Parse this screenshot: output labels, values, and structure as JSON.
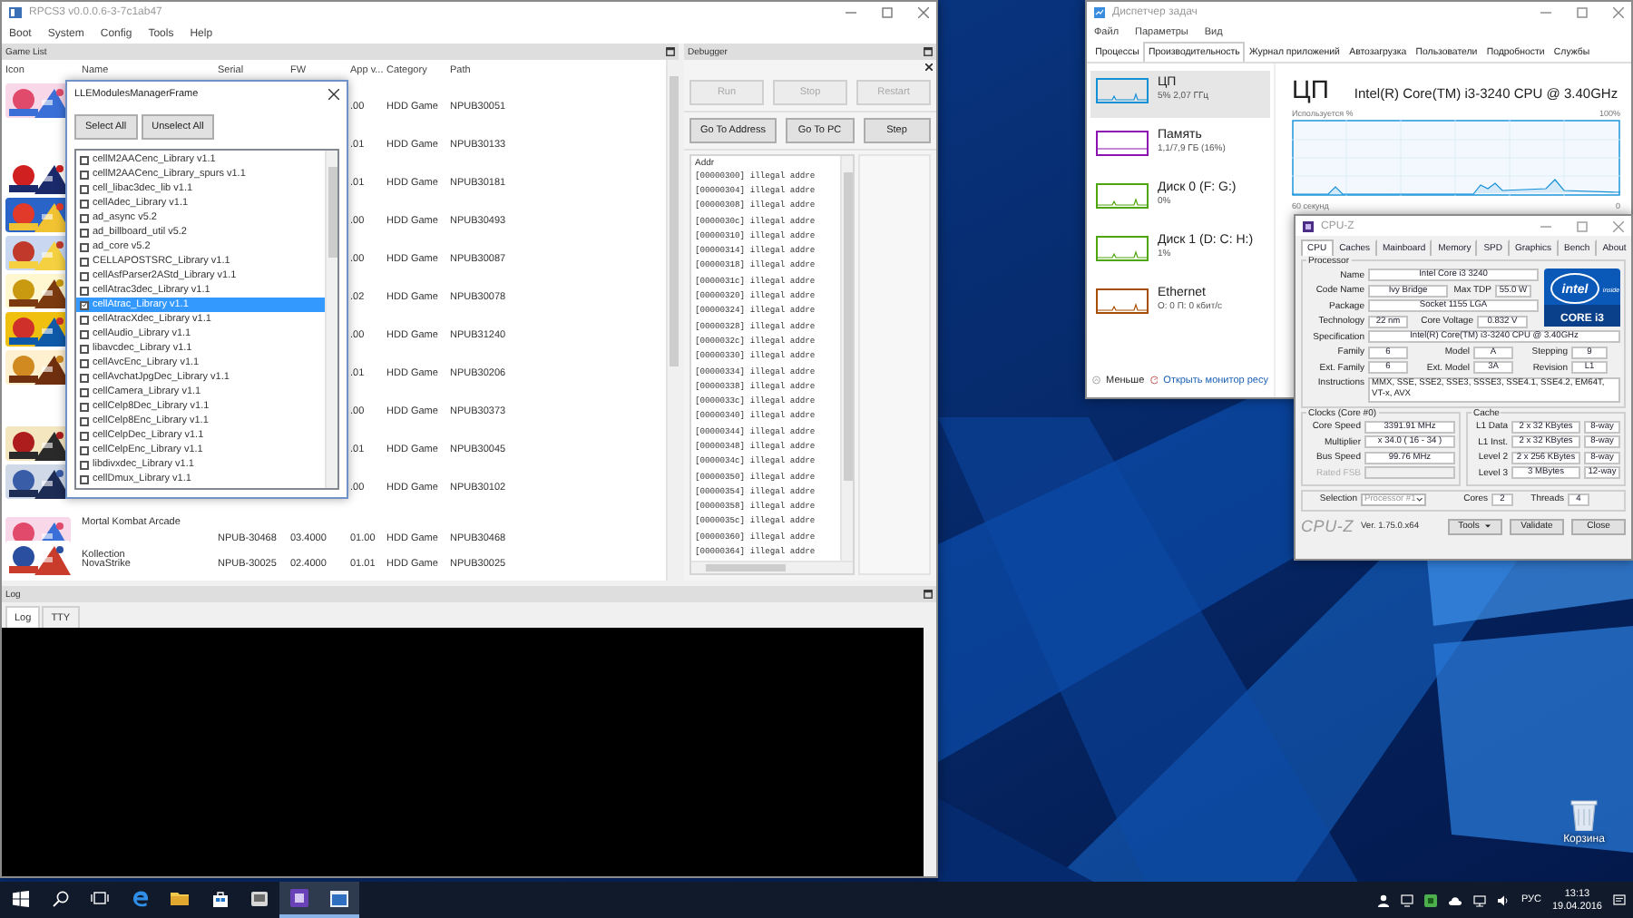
{
  "desktop": {
    "recycle_bin_label": "Корзина"
  },
  "rpcs3": {
    "title": "RPCS3 v0.0.0.6-3-7c1ab47",
    "menu": [
      "Boot",
      "System",
      "Config",
      "Tools",
      "Help"
    ],
    "game_list": {
      "title": "Game List",
      "columns": [
        "Icon",
        "Name",
        "Serial",
        "FW",
        "App v...",
        "Category",
        "Path"
      ],
      "rows": [
        {
          "app_version": ".00",
          "category": "HDD Game",
          "path": "NPUB30051"
        },
        {
          "app_version": ".01",
          "category": "HDD Game",
          "path": "NPUB30133"
        },
        {
          "app_version": ".01",
          "category": "HDD Game",
          "path": "NPUB30181"
        },
        {
          "app_version": ".00",
          "category": "HDD Game",
          "path": "NPUB30493"
        },
        {
          "app_version": ".00",
          "category": "HDD Game",
          "path": "NPUB30087"
        },
        {
          "app_version": ".02",
          "category": "HDD Game",
          "path": "NPUB30078"
        },
        {
          "app_version": ".00",
          "category": "HDD Game",
          "path": "NPUB31240"
        },
        {
          "app_version": ".01",
          "category": "HDD Game",
          "path": "NPUB30206"
        },
        {
          "app_version": ".00",
          "category": "HDD Game",
          "path": "NPUB30373"
        },
        {
          "app_version": ".01",
          "category": "HDD Game",
          "path": "NPUB30045"
        },
        {
          "app_version": ".00",
          "category": "HDD Game",
          "path": "NPUB30102"
        },
        {
          "name": "Mortal Kombat Arcade Kollection",
          "serial": "NPUB-30468",
          "fw": "03.4000",
          "app_version": "01.00",
          "category": "HDD Game",
          "path": "NPUB30468"
        },
        {
          "name": "NovaStrike",
          "serial": "NPUB-30025",
          "fw": "02.4000",
          "app_version": "01.01",
          "category": "HDD Game",
          "path": "NPUB30025"
        }
      ]
    },
    "lle_dialog": {
      "title": "LLEModulesManagerFrame",
      "buttons": [
        "Select All",
        "Unselect All"
      ],
      "modules": [
        {
          "label": "cellM2AACenc_Library v1.1",
          "checked": false,
          "selected": false
        },
        {
          "label": "cellM2AACenc_Library_spurs v1.1",
          "checked": false,
          "selected": false
        },
        {
          "label": "cell_libac3dec_lib v1.1",
          "checked": false,
          "selected": false
        },
        {
          "label": "cellAdec_Library v1.1",
          "checked": false,
          "selected": false
        },
        {
          "label": "ad_async v5.2",
          "checked": false,
          "selected": false
        },
        {
          "label": "ad_billboard_util v5.2",
          "checked": false,
          "selected": false
        },
        {
          "label": "ad_core v5.2",
          "checked": false,
          "selected": false
        },
        {
          "label": "CELLAPOSTSRC_Library v1.1",
          "checked": false,
          "selected": false
        },
        {
          "label": "cellAsfParser2AStd_Library v1.1",
          "checked": false,
          "selected": false
        },
        {
          "label": "cellAtrac3dec_Library v1.1",
          "checked": false,
          "selected": false
        },
        {
          "label": "cellAtrac_Library v1.1",
          "checked": true,
          "selected": true
        },
        {
          "label": "cellAtracXdec_Library v1.1",
          "checked": false,
          "selected": false
        },
        {
          "label": "cellAudio_Library v1.1",
          "checked": false,
          "selected": false
        },
        {
          "label": "libavcdec_Library v1.1",
          "checked": false,
          "selected": false
        },
        {
          "label": "cellAvcEnc_Library v1.1",
          "checked": false,
          "selected": false
        },
        {
          "label": "cellAvchatJpgDec_Library v1.1",
          "checked": false,
          "selected": false
        },
        {
          "label": "cellCamera_Library v1.1",
          "checked": false,
          "selected": false
        },
        {
          "label": "cellCelp8Dec_Library v1.1",
          "checked": false,
          "selected": false
        },
        {
          "label": "cellCelp8Enc_Library v1.1",
          "checked": false,
          "selected": false
        },
        {
          "label": "cellCelpDec_Library v1.1",
          "checked": false,
          "selected": false
        },
        {
          "label": "cellCelpEnc_Library v1.1",
          "checked": false,
          "selected": false
        },
        {
          "label": "libdivxdec_Library v1.1",
          "checked": false,
          "selected": false
        },
        {
          "label": "cellDmux_Library v1.1",
          "checked": false,
          "selected": false
        }
      ]
    },
    "debugger": {
      "title": "Debugger",
      "control_buttons": [
        {
          "label": "Run",
          "disabled": true
        },
        {
          "label": "Stop",
          "disabled": true
        },
        {
          "label": "Restart",
          "disabled": true
        }
      ],
      "nav_buttons": [
        "Go To Address",
        "Go To PC",
        "Step"
      ],
      "column": "Addr",
      "lines": [
        {
          "address": "[00000300]",
          "text": "illegal addre"
        },
        {
          "address": "[00000304]",
          "text": "illegal addre"
        },
        {
          "address": "[00000308]",
          "text": "illegal addre"
        },
        {
          "address": "[0000030c]",
          "text": "illegal addre"
        },
        {
          "address": "[00000310]",
          "text": "illegal addre"
        },
        {
          "address": "[00000314]",
          "text": "illegal addre"
        },
        {
          "address": "[00000318]",
          "text": "illegal addre"
        },
        {
          "address": "[0000031c]",
          "text": "illegal addre"
        },
        {
          "address": "[00000320]",
          "text": "illegal addre"
        },
        {
          "address": "[00000324]",
          "text": "illegal addre"
        },
        {
          "address": "[00000328]",
          "text": "illegal addre"
        },
        {
          "address": "[0000032c]",
          "text": "illegal addre"
        },
        {
          "address": "[00000330]",
          "text": "illegal addre"
        },
        {
          "address": "[00000334]",
          "text": "illegal addre"
        },
        {
          "address": "[00000338]",
          "text": "illegal addre"
        },
        {
          "address": "[0000033c]",
          "text": "illegal addre"
        },
        {
          "address": "[00000340]",
          "text": "illegal addre"
        },
        {
          "address": "[00000344]",
          "text": "illegal addre"
        },
        {
          "address": "[00000348]",
          "text": "illegal addre"
        },
        {
          "address": "[0000034c]",
          "text": "illegal addre"
        },
        {
          "address": "[00000350]",
          "text": "illegal addre"
        },
        {
          "address": "[00000354]",
          "text": "illegal addre"
        },
        {
          "address": "[00000358]",
          "text": "illegal addre"
        },
        {
          "address": "[0000035c]",
          "text": "illegal addre"
        },
        {
          "address": "[00000360]",
          "text": "illegal addre"
        },
        {
          "address": "[00000364]",
          "text": "illegal addre"
        }
      ]
    },
    "log": {
      "title": "Log",
      "tabs": [
        {
          "label": "Log",
          "selected": true
        },
        {
          "label": "TTY",
          "selected": false
        }
      ]
    }
  },
  "task_manager": {
    "title": "Диспетчер задач",
    "menu": [
      "Файл",
      "Параметры",
      "Вид"
    ],
    "tabs": [
      {
        "label": "Процессы",
        "selected": false
      },
      {
        "label": "Производительность",
        "selected": true
      },
      {
        "label": "Журнал приложений",
        "selected": false
      },
      {
        "label": "Автозагрузка",
        "selected": false
      },
      {
        "label": "Пользователи",
        "selected": false
      },
      {
        "label": "Подробности",
        "selected": false
      },
      {
        "label": "Службы",
        "selected": false
      }
    ],
    "resources": [
      {
        "name": "ЦП",
        "detail": "5% 2,07 ГГц",
        "color": "#1190d8",
        "selected": true
      },
      {
        "name": "Память",
        "detail": "1,1/7,9 ГБ (16%)",
        "color": "#8b12ae",
        "selected": false
      },
      {
        "name": "Диск 0 (F: G:)",
        "detail": "0%",
        "color": "#4da60c",
        "selected": false
      },
      {
        "name": "Диск 1 (D: C: H:)",
        "detail": "1%",
        "color": "#4da60c",
        "selected": false
      },
      {
        "name": "Ethernet",
        "detail": "О: 0 П: 0 кбит/с",
        "color": "#a74f01",
        "selected": false
      }
    ],
    "heading": "ЦП",
    "model": "Intel(R) Core(TM) i3-3240 CPU @ 3.40GHz",
    "graph": {
      "label": "Используется %",
      "max": "100%",
      "span": "60 секунд",
      "min": "0"
    },
    "footer": {
      "less": "Меньше",
      "monitor_link": "Открыть монитор ресу"
    }
  },
  "cpuz": {
    "title": "CPU-Z",
    "tabs": [
      {
        "label": "CPU",
        "selected": true
      },
      {
        "label": "Caches",
        "selected": false
      },
      {
        "label": "Mainboard",
        "selected": false
      },
      {
        "label": "Memory",
        "selected": false
      },
      {
        "label": "SPD",
        "selected": false
      },
      {
        "label": "Graphics",
        "selected": false
      },
      {
        "label": "Bench",
        "selected": false
      },
      {
        "label": "About",
        "selected": false
      }
    ],
    "processor": {
      "legend": "Processor",
      "name": {
        "label": "Name",
        "value": "Intel Core i3 3240"
      },
      "code_name": {
        "label": "Code Name",
        "value": "Ivy Bridge"
      },
      "max_tdp": {
        "label": "Max TDP",
        "value": "55.0 W"
      },
      "package": {
        "label": "Package",
        "value": "Socket 1155 LGA"
      },
      "technology": {
        "label": "Technology",
        "value": "22 nm"
      },
      "core_voltage": {
        "label": "Core Voltage",
        "value": "0.832 V"
      },
      "specification": {
        "label": "Specification",
        "value": "Intel(R) Core(TM) i3-3240 CPU @ 3.40GHz"
      },
      "family": {
        "label": "Family",
        "value": "6"
      },
      "model": {
        "label": "Model",
        "value": "A"
      },
      "stepping": {
        "label": "Stepping",
        "value": "9"
      },
      "ext_family": {
        "label": "Ext. Family",
        "value": "6"
      },
      "ext_model": {
        "label": "Ext. Model",
        "value": "3A"
      },
      "revision": {
        "label": "Revision",
        "value": "L1"
      },
      "instructions": {
        "label": "Instructions",
        "value": "MMX, SSE, SSE2, SSE3, SSSE3, SSE4.1, SSE4.2, EM64T, VT-x, AVX"
      },
      "logo": {
        "brand": "intel",
        "tagline": "inside",
        "line": "CORE i3"
      }
    },
    "clocks": {
      "legend": "Clocks (Core #0)",
      "rows": [
        {
          "label": "Core Speed",
          "value": "3391.91 MHz",
          "disabled": false
        },
        {
          "label": "Multiplier",
          "value": "x 34.0 ( 16 - 34 )",
          "disabled": false
        },
        {
          "label": "Bus Speed",
          "value": "99.76 MHz",
          "disabled": false
        },
        {
          "label": "Rated FSB",
          "disabled": true
        }
      ]
    },
    "cache": {
      "legend": "Cache",
      "rows": [
        {
          "label": "L1 Data",
          "size": "2 x 32 KBytes",
          "ways": "8-way"
        },
        {
          "label": "L1 Inst.",
          "size": "2 x 32 KBytes",
          "ways": "8-way"
        },
        {
          "label": "Level 2",
          "size": "2 x 256 KBytes",
          "ways": "8-way"
        },
        {
          "label": "Level 3",
          "size": "3 MBytes",
          "ways": "12-way"
        }
      ]
    },
    "selection": {
      "label": "Selection",
      "value": "Processor #1",
      "cores_label": "Cores",
      "cores": "2",
      "threads_label": "Threads",
      "threads": "4"
    },
    "footer": {
      "brand": "CPU-Z",
      "version": "Ver. 1.75.0.x64",
      "buttons": [
        "Tools",
        "Validate",
        "Close"
      ]
    }
  },
  "taskbar": {
    "apps": [
      {
        "kind": "start",
        "active": false
      },
      {
        "kind": "search",
        "active": false
      },
      {
        "kind": "task_view",
        "active": false
      },
      {
        "kind": "browser",
        "active": false
      },
      {
        "kind": "folder",
        "active": false
      },
      {
        "kind": "store",
        "active": false
      },
      {
        "kind": "app",
        "active": false
      },
      {
        "kind": "chip",
        "active": true
      },
      {
        "kind": "window",
        "active": true
      }
    ],
    "language": "РУС",
    "time": "13:13",
    "date": "19.04.2016"
  }
}
